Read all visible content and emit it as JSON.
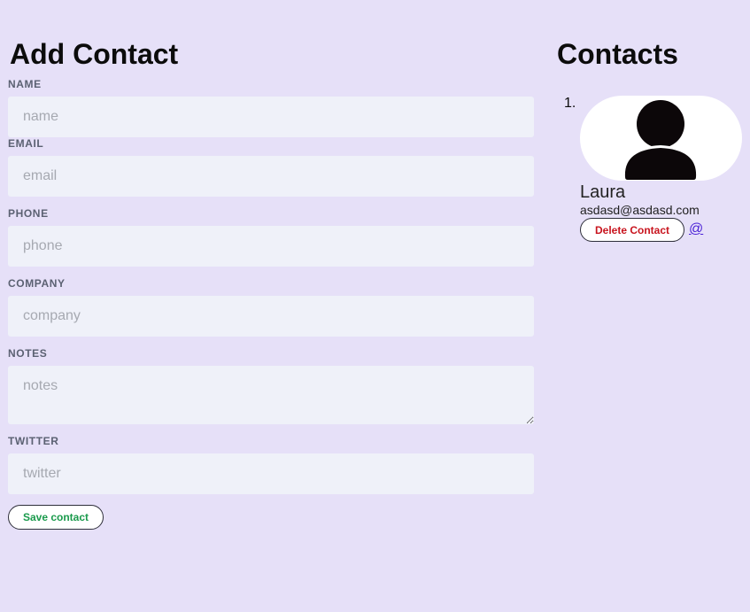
{
  "form": {
    "title": "Add Contact",
    "fields": {
      "name": {
        "label": "NAME",
        "placeholder": "name",
        "value": ""
      },
      "email": {
        "label": "EMAIL",
        "placeholder": "email",
        "value": ""
      },
      "phone": {
        "label": "PHONE",
        "placeholder": "phone",
        "value": ""
      },
      "company": {
        "label": "COMPANY",
        "placeholder": "company",
        "value": ""
      },
      "notes": {
        "label": "NOTES",
        "placeholder": "notes",
        "value": ""
      },
      "twitter": {
        "label": "TWITTER",
        "placeholder": "twitter",
        "value": ""
      }
    },
    "save_label": "Save contact"
  },
  "contacts": {
    "title": "Contacts",
    "items": [
      {
        "marker": "1.",
        "avatar_icon": "user-silhouette-icon",
        "name": "Laura",
        "email": "asdasd@asdasd.com",
        "delete_label": "Delete Contact",
        "twitter_link": "@"
      }
    ]
  },
  "colors": {
    "background": "#e6e0f8",
    "input_background": "#eff1f9",
    "save_text": "#1a9a4c",
    "delete_text": "#c8141e",
    "link": "#4a21d6"
  }
}
